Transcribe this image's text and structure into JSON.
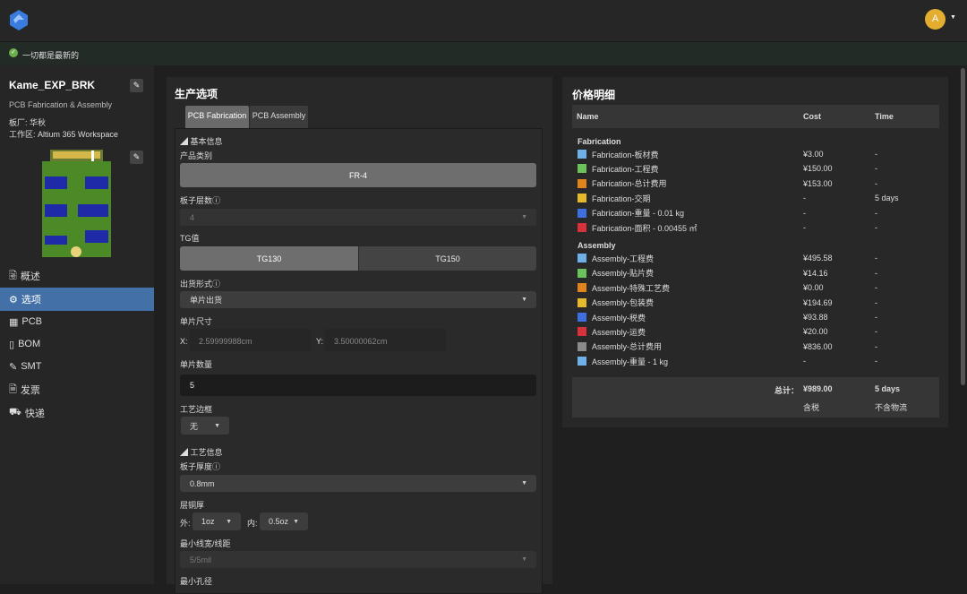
{
  "header": {
    "avatar_letter": "A"
  },
  "status": {
    "text": "一切都是最新的"
  },
  "project": {
    "name": "Kame_EXP_BRK",
    "subtitle": "PCB Fabrication & Assembly",
    "fab": "板厂: 华秋",
    "workspace": "工作区: Altium 365 Workspace"
  },
  "nav": [
    {
      "label": "概述",
      "icon": "overview-icon"
    },
    {
      "label": "选项",
      "icon": "gear-icon"
    },
    {
      "label": "PCB",
      "icon": "pcb-icon"
    },
    {
      "label": "BOM",
      "icon": "chip-icon"
    },
    {
      "label": "SMT",
      "icon": "brush-icon"
    },
    {
      "label": "发票",
      "icon": "invoice-icon"
    },
    {
      "label": "快递",
      "icon": "truck-icon"
    }
  ],
  "options": {
    "title": "生产选项",
    "tabs": [
      "PCB Fabrication",
      "PCB Assembly"
    ],
    "section_basic": "◢ 基本信息",
    "product_label": "产品类别",
    "product_value": "FR-4",
    "layers_label": "板子层数ⓘ",
    "layers_value": "4",
    "tg_label": "TG值",
    "tg_options": [
      "TG130",
      "TG150"
    ],
    "ship_label": "出货形式ⓘ",
    "ship_value": "单片出货",
    "size_label": "单片尺寸",
    "x_label": "X:",
    "x_value": "2.59999988cm",
    "y_label": "Y:",
    "y_value": "3.50000062cm",
    "qty_label": "单片数量",
    "qty_value": "5",
    "frame_label": "工艺边框",
    "frame_value": "无",
    "section_process": "◢ 工艺信息",
    "thick_label": "板子厚度ⓘ",
    "thick_value": "0.8mm",
    "copper_label": "层铜厚",
    "outer_label": "外:",
    "outer_value": "1oz",
    "inner_label": "内:",
    "inner_value": "0.5oz",
    "trace_label": "最小线宽/线距",
    "trace_value": "5/5mil",
    "hole_label": "最小孔径"
  },
  "price": {
    "title": "价格明细",
    "headers": [
      "Name",
      "Cost",
      "Time"
    ],
    "groups": [
      {
        "name": "Fabrication",
        "rows": [
          {
            "name": "Fabrication-板材费",
            "cost": "¥3.00",
            "time": "-",
            "color": "#6fb0e8"
          },
          {
            "name": "Fabrication-工程费",
            "cost": "¥150.00",
            "time": "-",
            "color": "#6cc25a"
          },
          {
            "name": "Fabrication-总计费用",
            "cost": "¥153.00",
            "time": "-",
            "color": "#e0841c"
          },
          {
            "name": "Fabrication-交期",
            "cost": "-",
            "time": "5 days",
            "color": "#e6b92a"
          },
          {
            "name": "Fabrication-重量 - 0.01 kg",
            "cost": "-",
            "time": "-",
            "color": "#3e6fe0"
          },
          {
            "name": "Fabrication-面积 - 0.00455 ㎡",
            "cost": "-",
            "time": "-",
            "color": "#d9303e"
          }
        ]
      },
      {
        "name": "Assembly",
        "rows": [
          {
            "name": "Assembly-工程费",
            "cost": "¥495.58",
            "time": "-",
            "color": "#6fb0e8"
          },
          {
            "name": "Assembly-贴片费",
            "cost": "¥14.16",
            "time": "-",
            "color": "#6cc25a"
          },
          {
            "name": "Assembly-特殊工艺费",
            "cost": "¥0.00",
            "time": "-",
            "color": "#e0841c"
          },
          {
            "name": "Assembly-包装费",
            "cost": "¥194.69",
            "time": "-",
            "color": "#e6b92a"
          },
          {
            "name": "Assembly-税费",
            "cost": "¥93.88",
            "time": "-",
            "color": "#3e6fe0"
          },
          {
            "name": "Assembly-运费",
            "cost": "¥20.00",
            "time": "-",
            "color": "#d9303e"
          },
          {
            "name": "Assembly-总计费用",
            "cost": "¥836.00",
            "time": "-",
            "color": "#8a8a8a"
          },
          {
            "name": "Assembly-重量 - 1 kg",
            "cost": "-",
            "time": "-",
            "color": "#6fb0e8"
          }
        ]
      }
    ],
    "total_label": "总计：",
    "total_cost": "¥989.00",
    "total_time": "5 days",
    "cost_note": "含税",
    "time_note": "不含物流"
  }
}
